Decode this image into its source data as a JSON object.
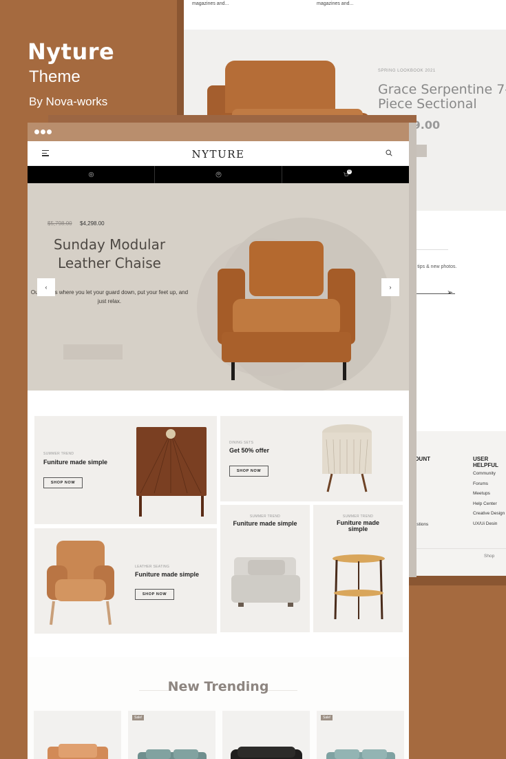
{
  "promo": {
    "brand": "Nyture",
    "theme": "Theme",
    "by": "By Nova-works"
  },
  "back_page": {
    "strip_left": "magazines and...",
    "strip_right": "magazines and...",
    "lookbook": "SPRING LOOKBOOK 2021",
    "title": "Grace Serpentine 7-Piece Sectional",
    "price": "$2,999.00",
    "newsletter_text": "Get tips & new photos.",
    "footer_col1": "ACCOUNT",
    "footer_col2": "USER HELPFUL",
    "footer_links": [
      "Community",
      "Forums",
      "Meetups",
      "Help Center",
      "Creative Design",
      "UX/Ui Desin"
    ],
    "questions_text": "Questions",
    "shop_link": "Shop"
  },
  "header": {
    "logo": "NYTURE"
  },
  "hero": {
    "old_price": "$5,798.00",
    "new_price": "$4,298.00",
    "title": "Sunday Modular Leather Chaise",
    "description": "Our sofa is where you let your guard down, put your feet up, and just relax.",
    "prev": "‹",
    "next": "›"
  },
  "categories": [
    {
      "subtitle": "SUMMER TREND",
      "title": "Funiture made simple",
      "button": "SHOP NOW"
    },
    {
      "subtitle": "DINING SETS",
      "title": "Get 50% offer",
      "button": "SHOP NOW"
    },
    {
      "subtitle": "LEATHER SEATING",
      "title": "Funiture made simple",
      "button": "SHOP NOW"
    },
    {
      "subtitle": "SUMMER TREND",
      "title": "Funiture made simple"
    },
    {
      "subtitle": "SUMMER TREND",
      "title": "Funiture made simple"
    }
  ],
  "trending": {
    "heading": "New Trending",
    "sale_badge": "Sale!"
  },
  "cart_count": "0",
  "colors": {
    "accent": "#a56a3f",
    "titlebar": "#b98e6d",
    "hero_bg": "#d6d0c7",
    "leather": "#b3672f"
  }
}
